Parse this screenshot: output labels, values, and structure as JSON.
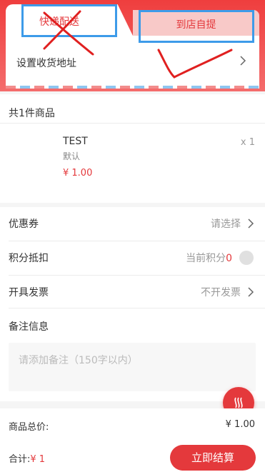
{
  "delivery": {
    "tab_express": "快递配送",
    "tab_pickup": "到店自提",
    "address_label": "设置收货地址"
  },
  "goods": {
    "count_label": "共1件商品",
    "items": [
      {
        "name": "TEST",
        "spec": "默认",
        "price": "¥ 1.00",
        "qty": "x 1"
      }
    ]
  },
  "options": {
    "coupon_label": "优惠券",
    "coupon_value": "请选择",
    "points_label": "积分抵扣",
    "points_prefix": "当前积分",
    "points_value": "0",
    "invoice_label": "开具发票",
    "invoice_value": "不开发票",
    "remark_label": "备注信息",
    "remark_placeholder": "请添加备注（150字以内）"
  },
  "summary": {
    "goods_total_label": "商品总价:",
    "goods_total_value": "¥ 1.00",
    "sum_label": "合计:",
    "sum_value": "¥ 1",
    "submit_label": "立即结算"
  },
  "colors": {
    "accent": "#e4393c",
    "annotation_box": "#3d9be9"
  }
}
